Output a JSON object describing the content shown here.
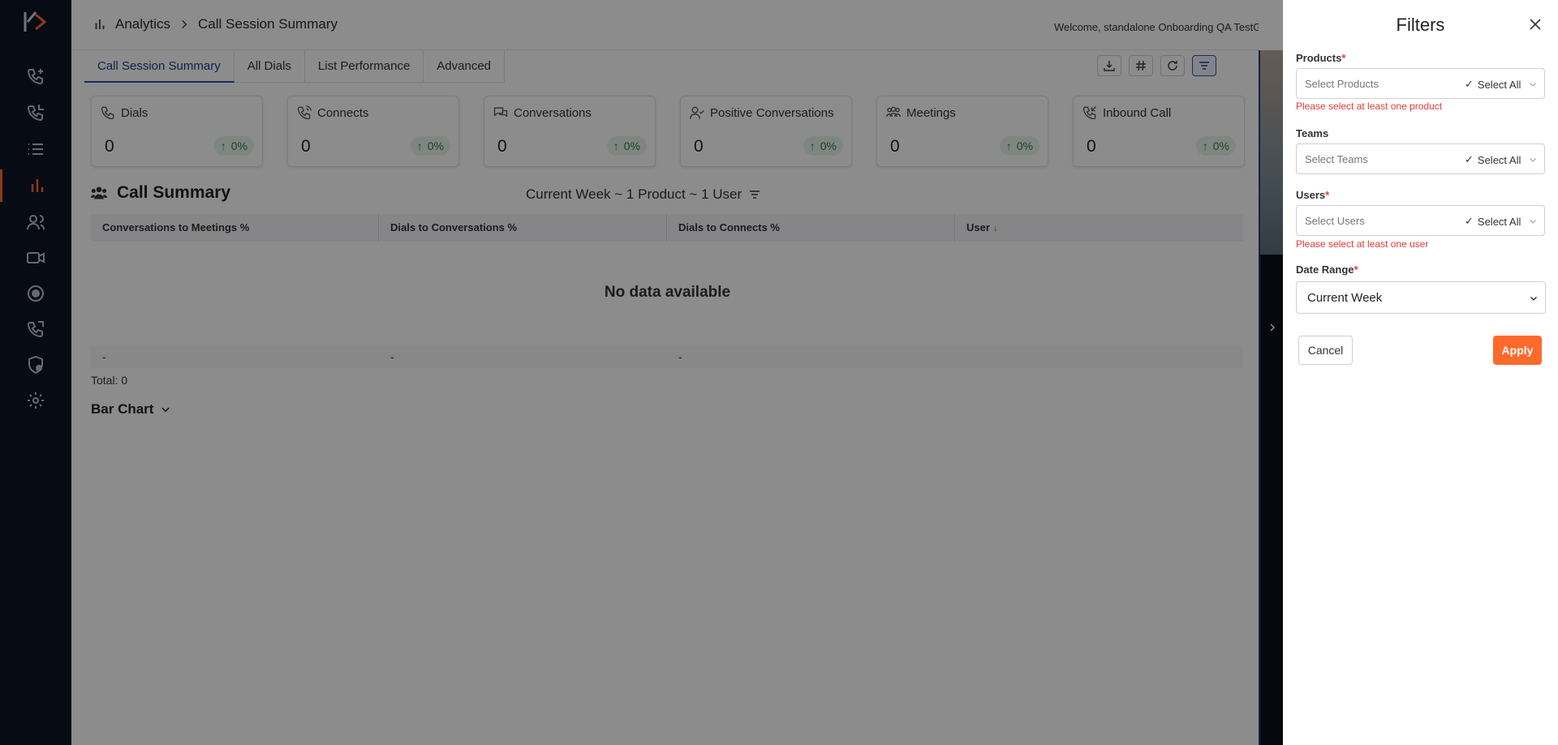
{
  "breadcrumb": {
    "section": "Analytics",
    "page": "Call Session Summary"
  },
  "welcome": "Welcome, standalone Onboarding QA TestG",
  "tabs": [
    {
      "label": "Call Session Summary",
      "active": true
    },
    {
      "label": "All Dials"
    },
    {
      "label": "List Performance"
    },
    {
      "label": "Advanced"
    }
  ],
  "toolbar": [
    "download-icon",
    "hash-icon",
    "refresh-icon",
    "filter-icon"
  ],
  "cards": [
    {
      "title": "Dials",
      "value": "0",
      "change": "0%",
      "icon": "phone-icon"
    },
    {
      "title": "Connects",
      "value": "0",
      "change": "0%",
      "icon": "phone-connect-icon"
    },
    {
      "title": "Conversations",
      "value": "0",
      "change": "0%",
      "icon": "chat-icon"
    },
    {
      "title": "Positive Conversations",
      "value": "0",
      "change": "0%",
      "icon": "user-check-icon"
    },
    {
      "title": "Meetings",
      "value": "0",
      "change": "0%",
      "icon": "group-icon"
    },
    {
      "title": "Inbound Call",
      "value": "0",
      "change": "0%",
      "icon": "inbound-call-icon"
    }
  ],
  "summary": {
    "title": "Call Summary",
    "filter_text": "Current Week ~ 1 Product ~ 1 User",
    "columns": [
      "Conversations to Meetings %",
      "Dials to Conversations %",
      "Dials to Connects %",
      "User"
    ],
    "no_data": "No data available",
    "footer": [
      "-",
      "-",
      "-",
      ""
    ],
    "total": "Total: 0",
    "chart_toggle": "Bar Chart"
  },
  "filters": {
    "title": "Filters",
    "products_label": "Products",
    "products_placeholder": "Select Products",
    "products_error": "Please select at least one product",
    "teams_label": "Teams",
    "teams_placeholder": "Select Teams",
    "users_label": "Users",
    "users_placeholder": "Select Users",
    "users_error": "Please select at least one user",
    "select_all": "Select All",
    "date_label": "Date Range",
    "date_value": "Current Week",
    "cancel": "Cancel",
    "apply": "Apply",
    "required_mark": "*"
  },
  "colors": {
    "accent": "#ff6a2c",
    "sidebar": "#0c1526",
    "error": "#e53935",
    "success": "#2f7d4a",
    "primary": "#3a4cb8"
  }
}
